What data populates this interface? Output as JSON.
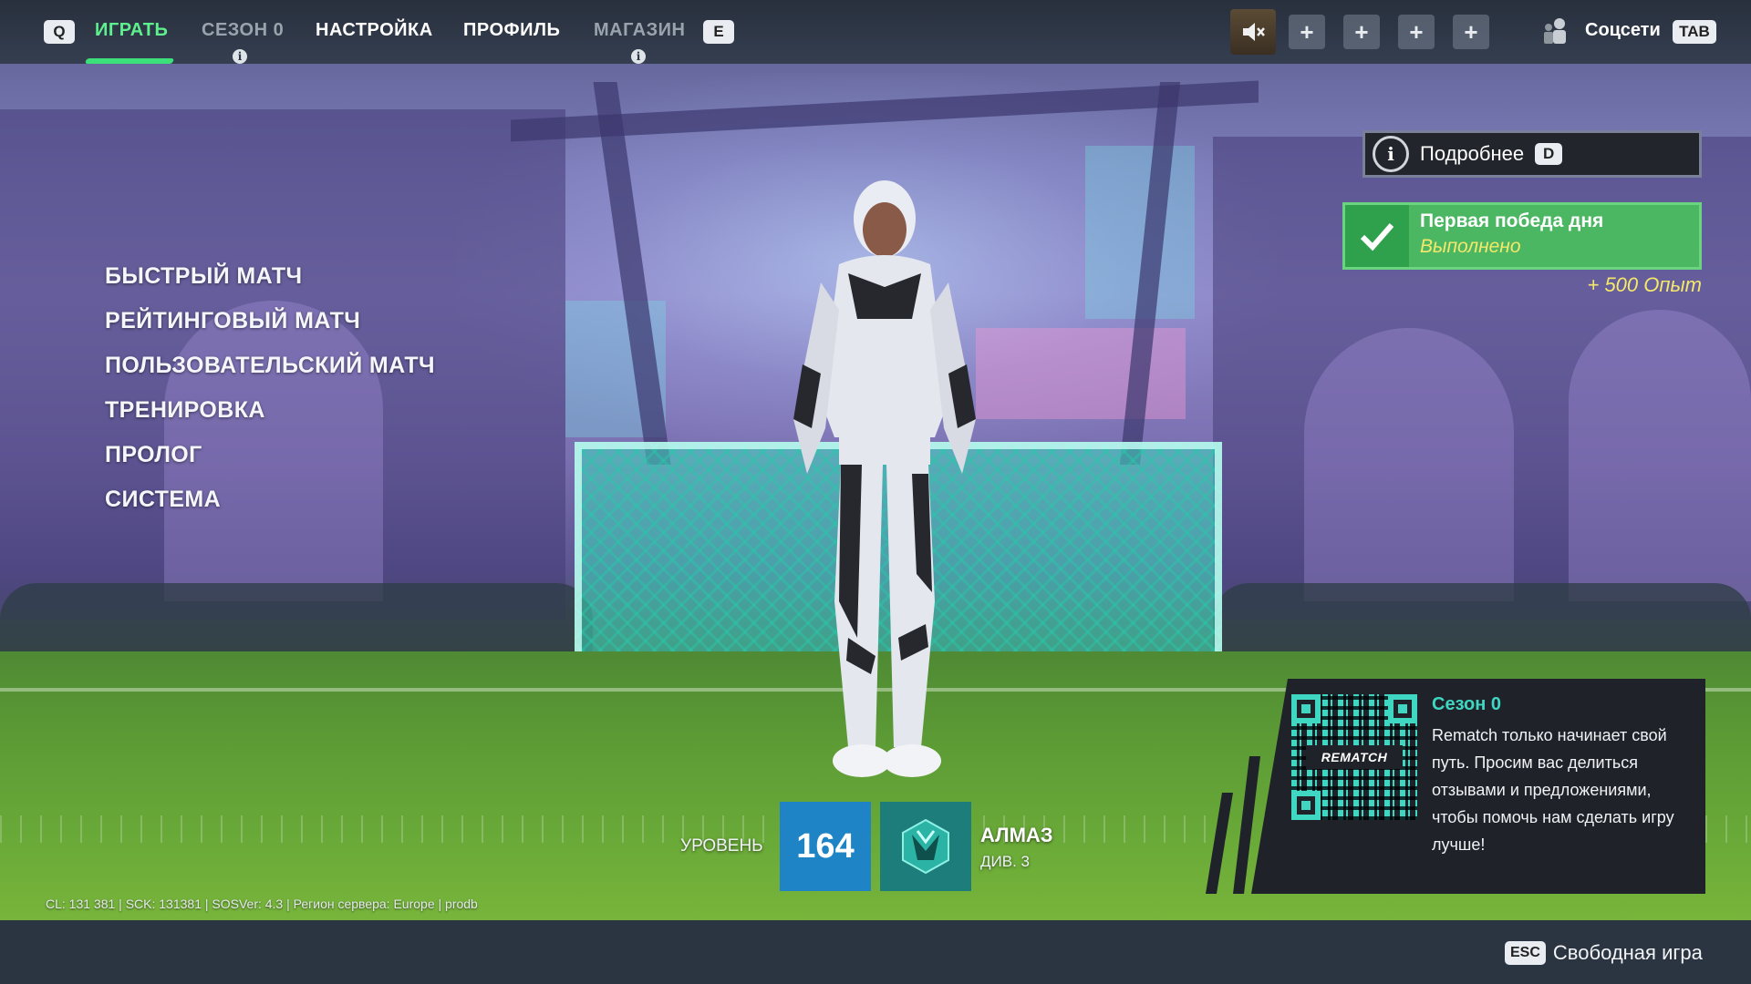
{
  "topnav": {
    "key_left": "Q",
    "key_right": "E",
    "tabs": [
      {
        "label": "ИГРАТЬ",
        "state": "active"
      },
      {
        "label": "СЕЗОН 0",
        "state": "dim"
      },
      {
        "label": "НАСТРОЙКА",
        "state": "normal"
      },
      {
        "label": "ПРОФИЛЬ",
        "state": "normal"
      },
      {
        "label": "МАГАЗИН",
        "state": "dim"
      }
    ],
    "party_slots": [
      "+",
      "+",
      "+",
      "+"
    ],
    "social_label": "Соцсети",
    "social_key": "TAB"
  },
  "menu": {
    "items": [
      "БЫСТРЫЙ МАТЧ",
      "РЕЙТИНГОВЫЙ МАТЧ",
      "ПОЛЬЗОВАТЕЛЬСКИЙ МАТЧ",
      "ТРЕНИРОВКА",
      "ПРОЛОГ",
      "СИСТЕМА"
    ]
  },
  "details": {
    "label": "Подробнее",
    "key": "D"
  },
  "quest": {
    "title": "Первая победа дня",
    "status": "Выполнено",
    "reward": "+ 500 Опыт"
  },
  "season": {
    "title": "Сезон 0",
    "body": "Rematch только начинает свой путь. Просим вас делиться отзывами и предложениями, чтобы помочь нам сделать игру лучше!",
    "qr_logo": "REMATCH"
  },
  "player": {
    "level_label": "УРОВЕНЬ",
    "level": "164",
    "rank": "АЛМАЗ",
    "division": "ДИВ. 3"
  },
  "buildinfo": "CL: 131 381 | SCK: 131381 | SOSVer: 4.3 | Регион сервера: Europe | prodb",
  "footer": {
    "esc_key": "ESC",
    "esc_label": "Свободная игра"
  },
  "colors": {
    "accent_green": "#5ef08f",
    "quest_green": "#4cb763",
    "season_teal": "#3fd6c2",
    "level_blue": "#1e84c6",
    "reward_yellow": "#f5e86a"
  }
}
